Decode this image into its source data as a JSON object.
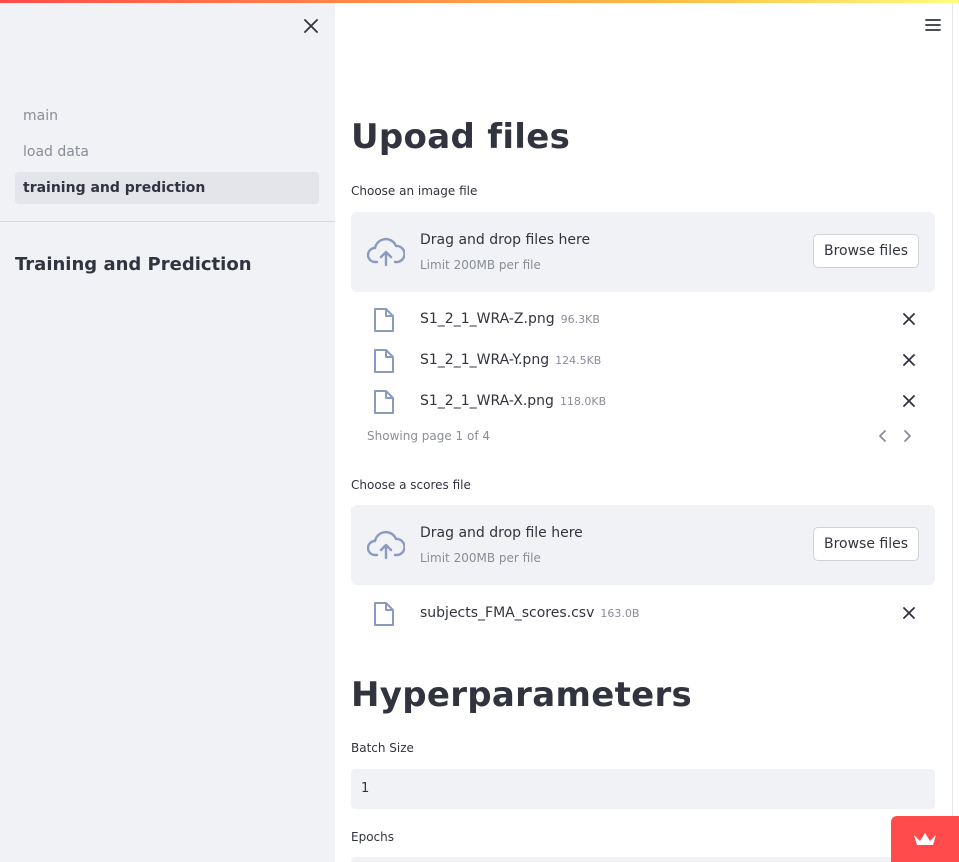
{
  "sidebar": {
    "close_icon": "close-icon",
    "nav": [
      {
        "label": "main"
      },
      {
        "label": "load data"
      },
      {
        "label": "training and prediction"
      }
    ],
    "title": "Training and Prediction"
  },
  "header": {
    "menu_icon": "hamburger-menu-icon"
  },
  "upload": {
    "heading": "Upoad files",
    "image_label": "Choose an image file",
    "image_dropzone": {
      "title": "Drag and drop files here",
      "limit": "Limit 200MB per file",
      "browse_label": "Browse files"
    },
    "image_files": [
      {
        "name": "S1_2_1_WRA-Z.png",
        "size": "96.3KB"
      },
      {
        "name": "S1_2_1_WRA-Y.png",
        "size": "124.5KB"
      },
      {
        "name": "S1_2_1_WRA-X.png",
        "size": "118.0KB"
      }
    ],
    "pager_text": "Showing page 1 of 4",
    "scores_label": "Choose a scores file",
    "scores_dropzone": {
      "title": "Drag and drop file here",
      "limit": "Limit 200MB per file",
      "browse_label": "Browse files"
    },
    "scores_files": [
      {
        "name": "subjects_FMA_scores.csv",
        "size": "163.0B"
      }
    ]
  },
  "hyper": {
    "heading": "Hyperparameters",
    "batch_label": "Batch Size",
    "batch_value": "1",
    "epochs_label": "Epochs"
  },
  "colors": {
    "primary": "#ff4b4b",
    "sidebar_bg": "#f0f2f6",
    "text": "#31333f",
    "muted": "#8a8d97",
    "icon": "#8b9ac0"
  }
}
